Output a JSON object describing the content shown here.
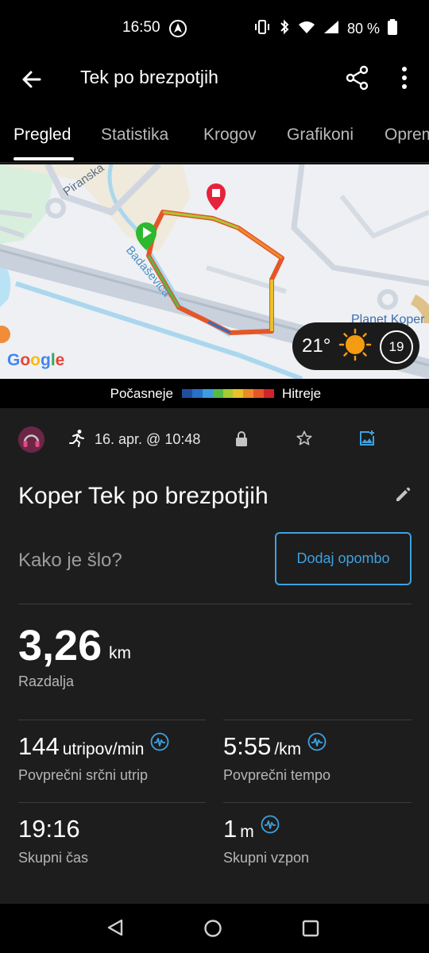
{
  "status": {
    "time": "16:50",
    "battery": "80 %"
  },
  "app_bar": {
    "title": "Tek po brezpotjih"
  },
  "tabs": [
    {
      "label": "Pregled",
      "active": true
    },
    {
      "label": "Statistika",
      "active": false
    },
    {
      "label": "Krogov",
      "active": false
    },
    {
      "label": "Grafikoni",
      "active": false
    },
    {
      "label": "Oprema",
      "active": false
    }
  ],
  "map": {
    "labels": {
      "road_1": "Piranska",
      "river": "Badaševica",
      "poi": "Planet Koper"
    },
    "attribution": "Google"
  },
  "weather": {
    "temperature": "21°",
    "wind": "19"
  },
  "legend": {
    "slower": "Počasneje",
    "faster": "Hitreje",
    "colors": [
      "#1f4e9e",
      "#2a6fc9",
      "#3d9be0",
      "#57b847",
      "#a8c935",
      "#e8c22a",
      "#ef8a2a",
      "#e4562a",
      "#d2232a"
    ]
  },
  "activity": {
    "date": "16. apr. @ 10:48",
    "title": "Koper Tek po brezpotjih",
    "prompt": "Kako je šlo?",
    "add_note": "Dodaj opombo"
  },
  "distance": {
    "value": "3,26",
    "unit": "km",
    "label": "Razdalja"
  },
  "stats": [
    {
      "value": "144",
      "unit": "utripov/min",
      "label": "Povprečni srčni utrip"
    },
    {
      "value": "5:55",
      "unit": "/km",
      "label": "Povprečni tempo"
    },
    {
      "value": "19:16",
      "unit": "",
      "label": "Skupni čas"
    },
    {
      "value": "1",
      "unit": "m",
      "label": "Skupni vzpon"
    }
  ]
}
